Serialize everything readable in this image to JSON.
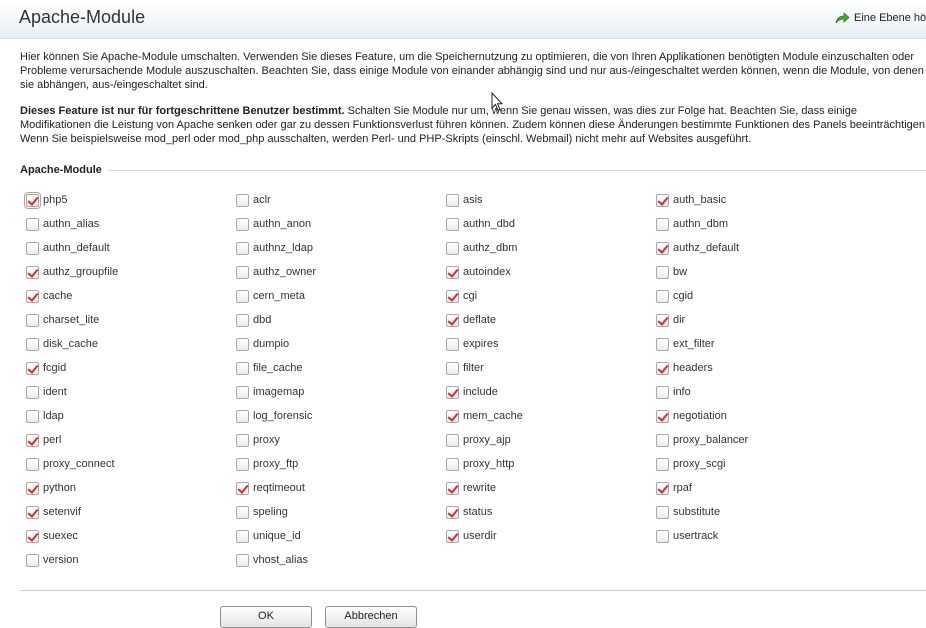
{
  "header": {
    "title": "Apache-Module",
    "up_level_label": "Eine Ebene hö",
    "up_level_icon": "arrow-up-green-icon"
  },
  "description": {
    "paragraph1": "Hier können Sie Apache-Module umschalten. Verwenden Sie dieses Feature, um die Speichernutzung zu optimieren, die von Ihren Applikationen benötigten Module einzuschalten oder Probleme verursachende Module auszuschalten. Beachten Sie, dass einige Module von einander abhängig sind und nur aus-/eingeschaltet werden können, wenn die Module, von denen sie abhängen, aus-/eingeschaltet sind.",
    "warning_bold": "Dieses Feature ist nur für fortgeschrittene Benutzer bestimmt.",
    "warning_rest": " Schalten Sie Module nur um, wenn Sie genau wissen, was dies zur Folge hat. Beachten Sie, dass einige Modifikationen die Leistung von Apache senken oder gar zu dessen Funktionsverlust führen können. Zudem können diese Änderungen bestimmte Funktionen des Panels beeinträchtigen. Wenn Sie beispielsweise mod_perl oder mod_php ausschalten, werden Perl- und PHP-Skripts (einschl. Webmail) nicht mehr auf Websites ausgeführt."
  },
  "section": {
    "title": "Apache-Module"
  },
  "modules": [
    {
      "name": "php5",
      "checked": true
    },
    {
      "name": "aclr",
      "checked": false
    },
    {
      "name": "asis",
      "checked": false
    },
    {
      "name": "auth_basic",
      "checked": true
    },
    {
      "name": "authn_alias",
      "checked": false
    },
    {
      "name": "authn_anon",
      "checked": false
    },
    {
      "name": "authn_dbd",
      "checked": false
    },
    {
      "name": "authn_dbm",
      "checked": false
    },
    {
      "name": "authn_default",
      "checked": false
    },
    {
      "name": "authnz_ldap",
      "checked": false
    },
    {
      "name": "authz_dbm",
      "checked": false
    },
    {
      "name": "authz_default",
      "checked": true
    },
    {
      "name": "authz_groupfile",
      "checked": true
    },
    {
      "name": "authz_owner",
      "checked": false
    },
    {
      "name": "autoindex",
      "checked": true
    },
    {
      "name": "bw",
      "checked": false
    },
    {
      "name": "cache",
      "checked": true
    },
    {
      "name": "cern_meta",
      "checked": false
    },
    {
      "name": "cgi",
      "checked": true
    },
    {
      "name": "cgid",
      "checked": false
    },
    {
      "name": "charset_lite",
      "checked": false
    },
    {
      "name": "dbd",
      "checked": false
    },
    {
      "name": "deflate",
      "checked": true
    },
    {
      "name": "dir",
      "checked": true
    },
    {
      "name": "disk_cache",
      "checked": false
    },
    {
      "name": "dumpio",
      "checked": false
    },
    {
      "name": "expires",
      "checked": false
    },
    {
      "name": "ext_filter",
      "checked": false
    },
    {
      "name": "fcgid",
      "checked": true
    },
    {
      "name": "file_cache",
      "checked": false
    },
    {
      "name": "filter",
      "checked": false
    },
    {
      "name": "headers",
      "checked": true
    },
    {
      "name": "ident",
      "checked": false
    },
    {
      "name": "imagemap",
      "checked": false
    },
    {
      "name": "include",
      "checked": true
    },
    {
      "name": "info",
      "checked": false
    },
    {
      "name": "ldap",
      "checked": false
    },
    {
      "name": "log_forensic",
      "checked": false
    },
    {
      "name": "mem_cache",
      "checked": true
    },
    {
      "name": "negotiation",
      "checked": true
    },
    {
      "name": "perl",
      "checked": true
    },
    {
      "name": "proxy",
      "checked": false
    },
    {
      "name": "proxy_ajp",
      "checked": false
    },
    {
      "name": "proxy_balancer",
      "checked": false
    },
    {
      "name": "proxy_connect",
      "checked": false
    },
    {
      "name": "proxy_ftp",
      "checked": false
    },
    {
      "name": "proxy_http",
      "checked": false
    },
    {
      "name": "proxy_scgi",
      "checked": false
    },
    {
      "name": "python",
      "checked": true
    },
    {
      "name": "reqtimeout",
      "checked": true
    },
    {
      "name": "rewrite",
      "checked": true
    },
    {
      "name": "rpaf",
      "checked": true
    },
    {
      "name": "setenvif",
      "checked": true
    },
    {
      "name": "speling",
      "checked": false
    },
    {
      "name": "status",
      "checked": true
    },
    {
      "name": "substitute",
      "checked": false
    },
    {
      "name": "suexec",
      "checked": true
    },
    {
      "name": "unique_id",
      "checked": false
    },
    {
      "name": "userdir",
      "checked": true
    },
    {
      "name": "usertrack",
      "checked": false
    },
    {
      "name": "version",
      "checked": false
    },
    {
      "name": "vhost_alias",
      "checked": false
    }
  ],
  "buttons": {
    "ok": "OK",
    "cancel": "Abbrechen"
  },
  "colors": {
    "checkmark": "#d1302a",
    "header_bg": "#e8eef4"
  }
}
